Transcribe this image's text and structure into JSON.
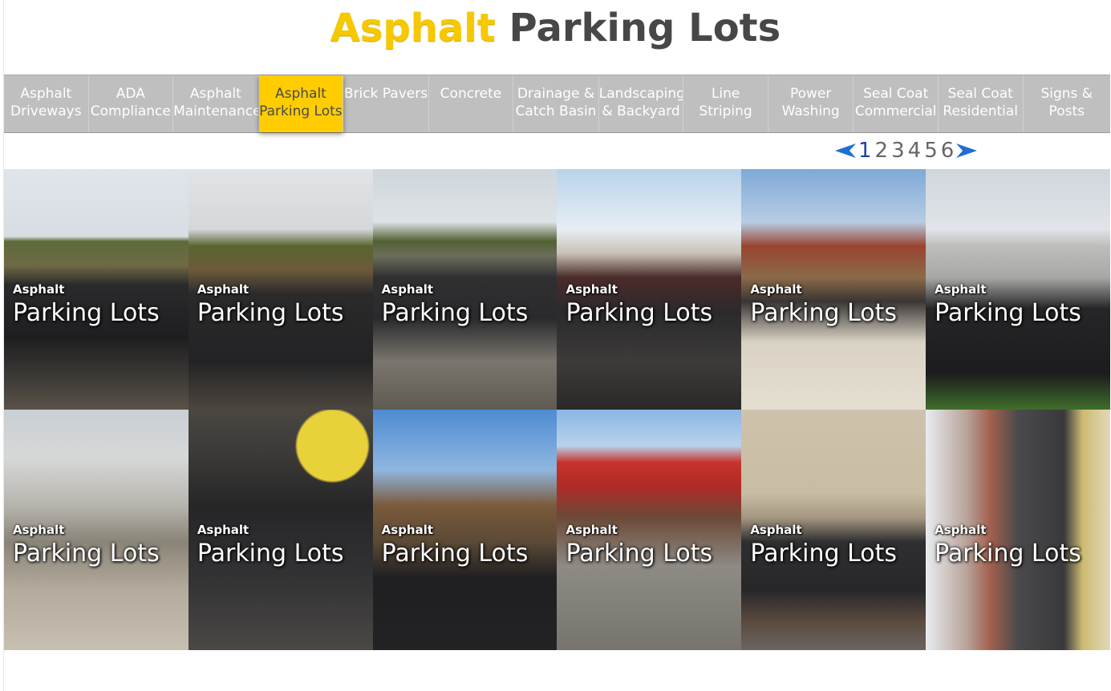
{
  "header": {
    "title_highlight": "Asphalt",
    "title_rest": "Parking Lots"
  },
  "nav": {
    "items": [
      {
        "line1": "Asphalt",
        "line2": "Driveways"
      },
      {
        "line1": "ADA",
        "line2": "Compliance"
      },
      {
        "line1": "Asphalt",
        "line2": "Maintenance"
      },
      {
        "line1": "Asphalt",
        "line2": "Parking Lots",
        "active": true
      },
      {
        "line1": "Brick Pavers",
        "line2": ""
      },
      {
        "line1": "Concrete",
        "line2": ""
      },
      {
        "line1": "Drainage &",
        "line2": "Catch Basin"
      },
      {
        "line1": "Landscaping",
        "line2": "& Backyard"
      },
      {
        "line1": "Line",
        "line2": "Striping"
      },
      {
        "line1": "Power",
        "line2": "Washing"
      },
      {
        "line1": "Seal Coat",
        "line2": "Commercial"
      },
      {
        "line1": "Seal Coat",
        "line2": "Residential"
      },
      {
        "line1": "Signs &",
        "line2": "Posts"
      }
    ],
    "active_color": "#ffcc00",
    "bar_color": "#bfbfbf"
  },
  "pager": {
    "prev_icon": "left-arrow-icon",
    "next_icon": "right-arrow-icon",
    "pages": [
      "1",
      "2",
      "3",
      "4",
      "5",
      "6"
    ],
    "current": "1"
  },
  "gallery": {
    "tiles": [
      {
        "kicker": "Asphalt",
        "heading": "Parking Lots"
      },
      {
        "kicker": "Asphalt",
        "heading": "Parking Lots"
      },
      {
        "kicker": "Asphalt",
        "heading": "Parking Lots"
      },
      {
        "kicker": "Asphalt",
        "heading": "Parking Lots"
      },
      {
        "kicker": "Asphalt",
        "heading": "Parking Lots"
      },
      {
        "kicker": "Asphalt",
        "heading": "Parking Lots"
      },
      {
        "kicker": "Asphalt",
        "heading": "Parking Lots"
      },
      {
        "kicker": "Asphalt",
        "heading": "Parking Lots"
      },
      {
        "kicker": "Asphalt",
        "heading": "Parking Lots"
      },
      {
        "kicker": "Asphalt",
        "heading": "Parking Lots"
      },
      {
        "kicker": "Asphalt",
        "heading": "Parking Lots"
      },
      {
        "kicker": "Asphalt",
        "heading": "Parking Lots"
      }
    ]
  },
  "colors": {
    "title_highlight": "#f5c800",
    "title_text": "#474747",
    "pager_current": "#1a3fb0",
    "pager_arrow": "#1e6fd0"
  }
}
